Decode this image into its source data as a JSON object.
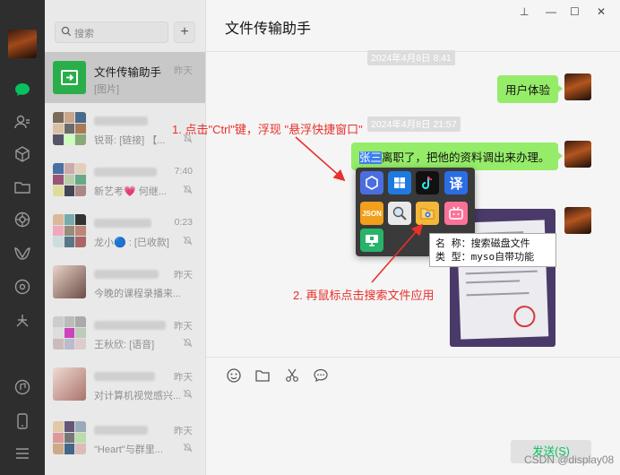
{
  "sidebar": {
    "icons": [
      "chat-icon",
      "contacts-icon",
      "favorites-icon",
      "folder-icon",
      "moments-icon",
      "channels-icon",
      "miniprogram-icon",
      "search-discover-icon",
      "music-icon",
      "phone-icon",
      "menu-icon"
    ]
  },
  "search": {
    "placeholder": "搜索",
    "plus": "+"
  },
  "chats": [
    {
      "name": "文件传输助手",
      "time": "昨天",
      "preview": "[图片]"
    },
    {
      "name": "",
      "time": "",
      "preview": "锐哥: [链接] 【..."
    },
    {
      "name": "",
      "time": "7:40",
      "preview": "新艺考💗 何继..."
    },
    {
      "name": "",
      "time": "0:23",
      "preview": "龙小🔵 : [已收款]"
    },
    {
      "name": "",
      "time": "昨天",
      "preview": "今晚的课程录播来..."
    },
    {
      "name": "",
      "time": "昨天",
      "preview": "王秋欣: [语音]"
    },
    {
      "name": "",
      "time": "昨天",
      "preview": "对计算机视觉感兴..."
    },
    {
      "name": "",
      "time": "昨天",
      "preview": "\"Heart\"与群里..."
    }
  ],
  "window": {
    "title": "文件传输助手",
    "controls": [
      "⊥",
      "—",
      "☐",
      "✕"
    ]
  },
  "messages": {
    "ts1": "2024年4月8日 8:41",
    "m1": "用户体验",
    "ts2": "2024年4月8日 21:57",
    "m2_hl": "张三",
    "m2_rest": "离职了，把他的资料调出来办理。"
  },
  "quick_panel": {
    "icons": [
      "box-app-icon",
      "windows-app-icon",
      "tiktok-app-icon",
      "baidu-translate-icon",
      "json-app-icon",
      "magnifier-app-icon",
      "file-search-app-icon",
      "bilibili-app-icon",
      "remote-desktop-icon"
    ],
    "json_label": "JSON",
    "translate_label": "译"
  },
  "tooltip": {
    "line1": "名 称：搜索磁盘文件",
    "line2": "类 型：myso自带功能"
  },
  "annotations": {
    "a1": "1. 点击\"Ctrl\"键，浮现 \"悬浮快捷窗口\"",
    "a2": "2. 再鼠标点击搜索文件应用"
  },
  "composer": {
    "send": "发送(S)"
  },
  "watermark": "CSDN @display08",
  "colors": {
    "accent": "#07c160",
    "bubble": "#95ec69",
    "annotation": "#e8302c",
    "rail": "#2e2e2e"
  }
}
